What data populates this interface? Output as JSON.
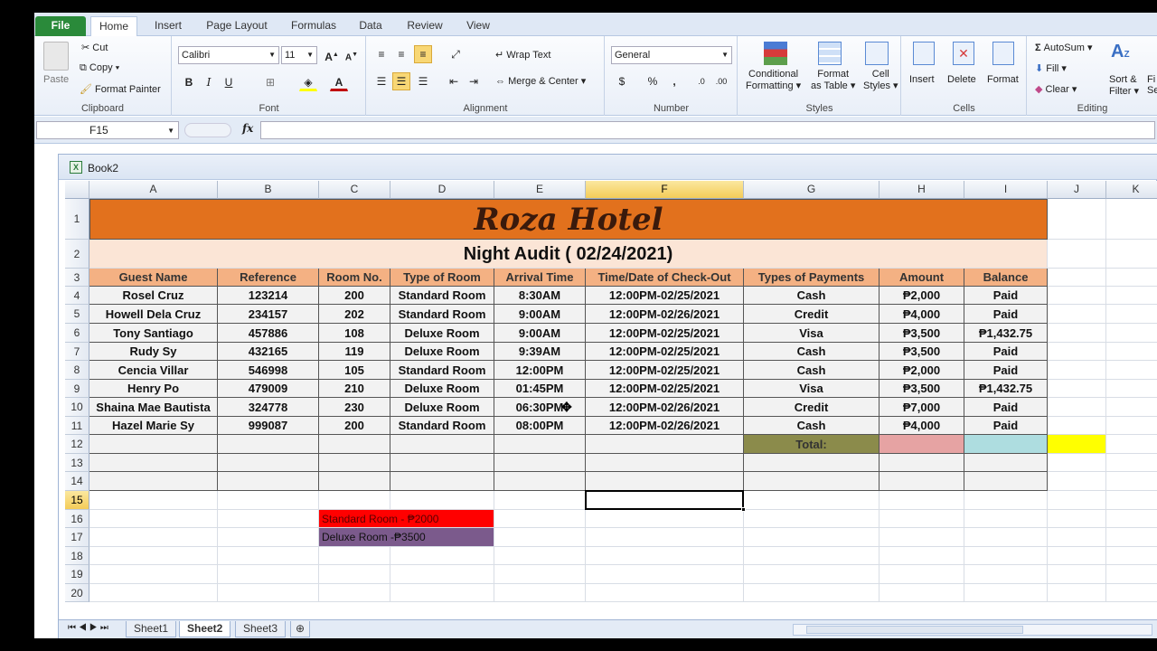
{
  "ribbon_tabs": [
    "File",
    "Home",
    "Insert",
    "Page Layout",
    "Formulas",
    "Data",
    "Review",
    "View"
  ],
  "clipboard": {
    "paste": "Paste",
    "cut": "Cut",
    "copy": "Copy",
    "format_painter": "Format Painter",
    "label": "Clipboard"
  },
  "font": {
    "name": "Calibri",
    "size": "11",
    "label": "Font",
    "bold": "B",
    "italic": "I",
    "underline": "U"
  },
  "alignment": {
    "wrap_text": "Wrap Text",
    "merge_center": "Merge & Center",
    "label": "Alignment"
  },
  "number": {
    "format": "General",
    "label": "Number",
    "percent": "%",
    "comma": ","
  },
  "styles": {
    "conditional": "Conditional",
    "conditional2": "Formatting",
    "format_as": "Format",
    "format_as2": "as Table",
    "cell": "Cell",
    "cell2": "Styles",
    "label": "Styles"
  },
  "cells": {
    "insert": "Insert",
    "delete": "Delete",
    "format": "Format",
    "label": "Cells"
  },
  "editing": {
    "autosum": "AutoSum",
    "fill": "Fill",
    "clear": "Clear",
    "sort": "Sort &",
    "sort2": "Filter",
    "find": "Fi",
    "find2": "Se",
    "label": "Editing"
  },
  "formula_bar": {
    "name_box": "F15",
    "fx": "fx",
    "value": ""
  },
  "workbook": {
    "title": "Book2"
  },
  "columns": [
    "A",
    "B",
    "C",
    "D",
    "E",
    "F",
    "G",
    "H",
    "I",
    "J",
    "K"
  ],
  "rows": [
    "1",
    "2",
    "3",
    "4",
    "5",
    "6",
    "7",
    "8",
    "9",
    "10",
    "11",
    "12",
    "13",
    "14",
    "15",
    "16",
    "17",
    "18",
    "19",
    "20"
  ],
  "sheet": {
    "title": "Roza Hotel",
    "subtitle": "Night Audit ( 02/24/2021)",
    "headers": [
      "Guest Name",
      "Reference",
      "Room No.",
      "Type of Room",
      "Arrival Time",
      "Time/Date of Check-Out",
      "Types of Payments",
      "Amount",
      "Balance"
    ],
    "data": [
      [
        "Rosel Cruz",
        "123214",
        "200",
        "Standard Room",
        "8:30AM",
        "12:00PM-02/25/2021",
        "Cash",
        "₱2,000",
        "Paid"
      ],
      [
        "Howell Dela Cruz",
        "234157",
        "202",
        "Standard Room",
        "9:00AM",
        "12:00PM-02/26/2021",
        "Credit",
        "₱4,000",
        "Paid"
      ],
      [
        "Tony Santiago",
        "457886",
        "108",
        "Deluxe Room",
        "9:00AM",
        "12:00PM-02/25/2021",
        "Visa",
        "₱3,500",
        "₱1,432.75"
      ],
      [
        "Rudy Sy",
        "432165",
        "119",
        "Deluxe Room",
        "9:39AM",
        "12:00PM-02/25/2021",
        "Cash",
        "₱3,500",
        "Paid"
      ],
      [
        "Cencia Villar",
        "546998",
        "105",
        "Standard Room",
        "12:00PM",
        "12:00PM-02/25/2021",
        "Cash",
        "₱2,000",
        "Paid"
      ],
      [
        "Henry Po",
        "479009",
        "210",
        "Deluxe Room",
        "01:45PM",
        "12:00PM-02/25/2021",
        "Visa",
        "₱3,500",
        "₱1,432.75"
      ],
      [
        "Shaina Mae Bautista",
        "324778",
        "230",
        "Deluxe Room",
        "06:30PM",
        "12:00PM-02/26/2021",
        "Credit",
        "₱7,000",
        "Paid"
      ],
      [
        "Hazel Marie Sy",
        "999087",
        "200",
        "Standard Room",
        "08:00PM",
        "12:00PM-02/26/2021",
        "Cash",
        "₱4,000",
        "Paid"
      ]
    ],
    "total_label": "Total:",
    "legend_standard": "Standard Room - ₱2000",
    "legend_deluxe": "Deluxe Room -₱3500"
  },
  "sheet_tabs": [
    "Sheet1",
    "Sheet2",
    "Sheet3"
  ],
  "active_sheet": "Sheet2",
  "colors": {
    "title_bg": "#e2711d",
    "subtitle_bg": "#fbe5d6",
    "header_bg": "#f4b183",
    "total_label_bg": "#8b8b4b",
    "amount_total_bg": "#e6a3a3",
    "balance_total_bg": "#aedde0",
    "j12_bg": "#ffff00",
    "standard_bg": "#ff0000",
    "deluxe_bg": "#7b5a8c"
  }
}
